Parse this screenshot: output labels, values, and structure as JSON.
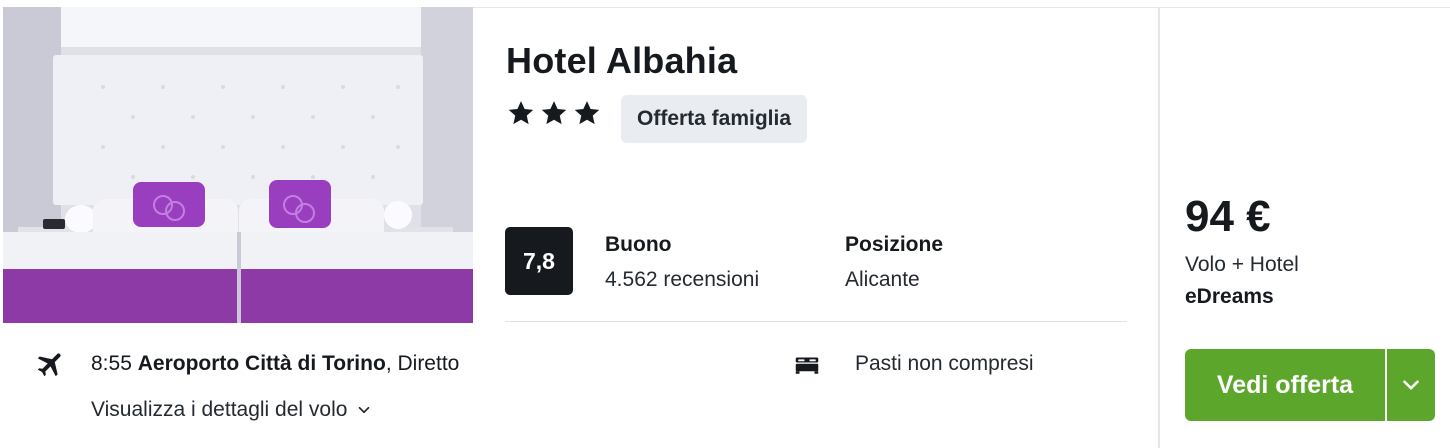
{
  "hotel": {
    "name": "Hotel Albahia",
    "stars": 3,
    "tag": "Offerta famiglia"
  },
  "rating": {
    "score": "7,8",
    "label": "Buono",
    "reviews": "4.562 recensioni"
  },
  "location": {
    "label": "Posizione",
    "value": "Alicante"
  },
  "flight": {
    "time": "8:55",
    "airport": "Aeroporto Città di Torino",
    "type": ", Diretto",
    "details_link": "Visualizza i dettagli del volo"
  },
  "meals": "Pasti non compresi",
  "offer": {
    "price": "94 €",
    "package": "Volo + Hotel",
    "provider": "eDreams",
    "cta_label": "Vedi offerta"
  },
  "colors": {
    "cta": "#5ca72b",
    "score_bg": "#161a1f",
    "tag_bg": "#e9ecf0",
    "room_purple": "#8e3aa6"
  },
  "icons": {
    "star": "star-icon",
    "flight": "airplane-icon",
    "bed": "bed-icon",
    "chevron": "chevron-down-icon"
  }
}
